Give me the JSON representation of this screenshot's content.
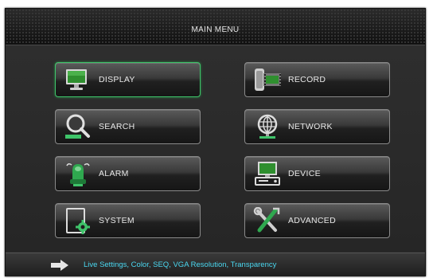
{
  "title": "MAIN MENU",
  "menu": {
    "display": "DISPLAY",
    "record": "RECORD",
    "search": "SEARCH",
    "network": "NETWORK",
    "alarm": "ALARM",
    "device": "DEVICE",
    "system": "SYSTEM",
    "advanced": "ADVANCED"
  },
  "selected": "display",
  "status": {
    "hint": "Live Settings, Color, SEQ, VGA Resolution, Transparency"
  },
  "icons": {
    "display": "monitor-icon",
    "record": "film-record-icon",
    "search": "magnifier-icon",
    "network": "globe-network-icon",
    "alarm": "alarm-light-icon",
    "device": "computer-device-icon",
    "system": "system-gear-icon",
    "advanced": "tools-icon",
    "status": "arrow-right-icon"
  },
  "colors": {
    "accent_green": "#3fc46a",
    "hint_text": "#4ad7f0"
  }
}
